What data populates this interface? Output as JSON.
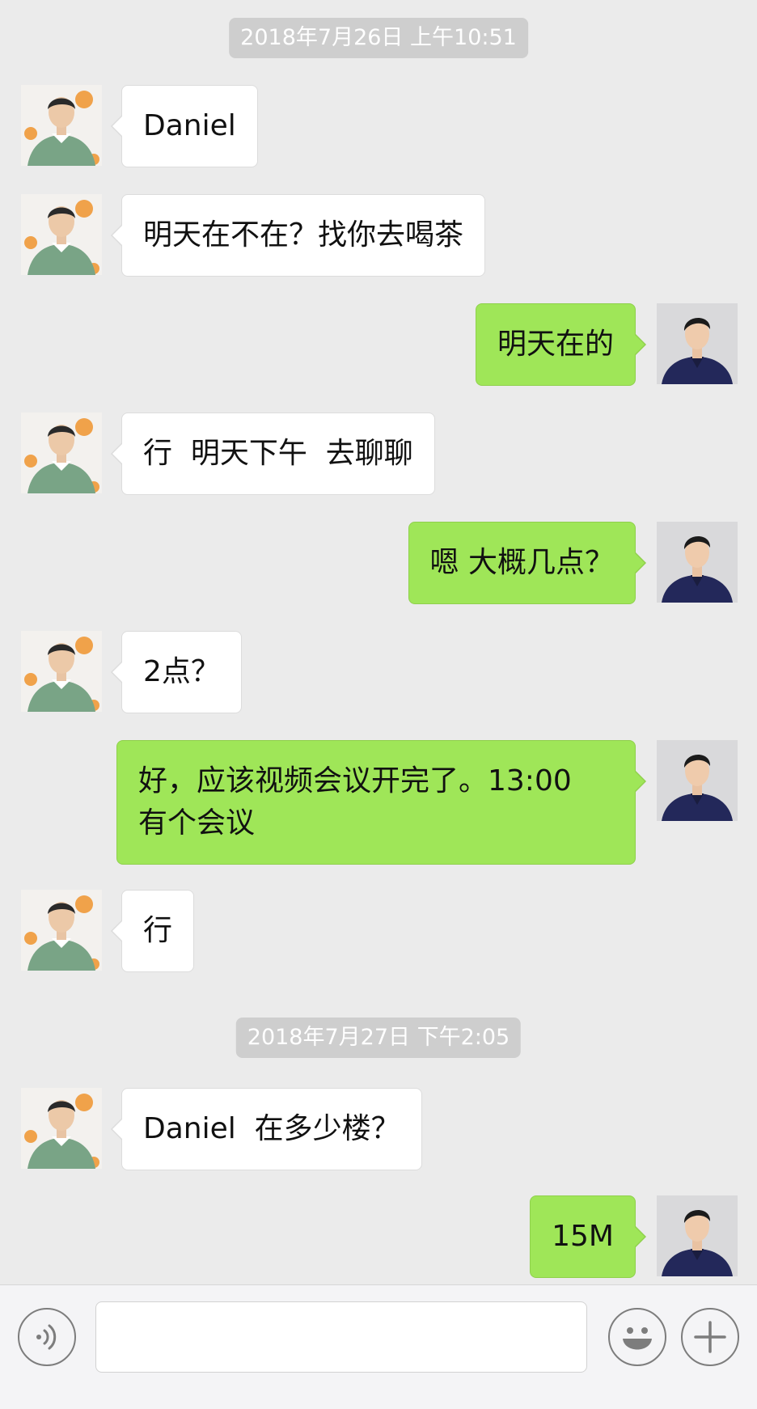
{
  "chat": {
    "timestamps": [
      "2018年7月26日 上午10:51",
      "2018年7月27日 下午2:05"
    ],
    "messages": [
      {
        "side": "in",
        "text": "Daniel"
      },
      {
        "side": "in",
        "text": "明天在不在？找你去喝茶"
      },
      {
        "side": "out",
        "text": "明天在的"
      },
      {
        "side": "in",
        "text": "行  明天下午  去聊聊"
      },
      {
        "side": "out",
        "text": "嗯 大概几点？"
      },
      {
        "side": "in",
        "text": "2点？"
      },
      {
        "side": "out",
        "text": "好，应该视频会议开完了。13:00\n有个会议"
      },
      {
        "side": "in",
        "text": "行"
      },
      {
        "side": "in",
        "text": "Daniel  在多少楼？"
      },
      {
        "side": "out",
        "text": "15M"
      }
    ]
  },
  "input_bar": {
    "voice_icon": "voice-icon",
    "text_value": "",
    "emoji_icon": "emoji-icon",
    "add_icon": "plus-icon"
  },
  "colors": {
    "background": "#ebebeb",
    "incoming_bubble": "#ffffff",
    "outgoing_bubble": "#9fe658",
    "timestamp_bg": "#cecece"
  }
}
